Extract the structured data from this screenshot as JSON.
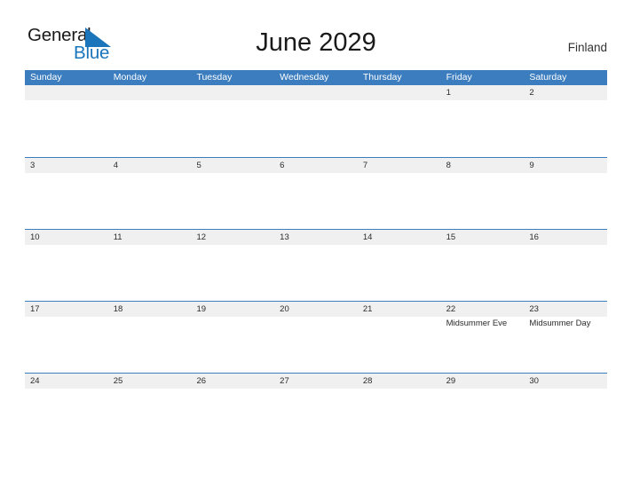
{
  "brand": {
    "name_part1": "General",
    "name_part2": "Blue",
    "flag_icon": "blue-triangle-flag-icon",
    "color_dark": "#1a1a1a",
    "color_blue": "#1b75bb"
  },
  "header": {
    "title": "June 2029",
    "region": "Finland"
  },
  "calendar": {
    "accent_color": "#3b7dbf",
    "band_color": "#f0f0f0",
    "weekdays": [
      "Sunday",
      "Monday",
      "Tuesday",
      "Wednesday",
      "Thursday",
      "Friday",
      "Saturday"
    ],
    "weeks": [
      [
        {
          "day": ""
        },
        {
          "day": ""
        },
        {
          "day": ""
        },
        {
          "day": ""
        },
        {
          "day": ""
        },
        {
          "day": "1"
        },
        {
          "day": "2"
        }
      ],
      [
        {
          "day": "3"
        },
        {
          "day": "4"
        },
        {
          "day": "5"
        },
        {
          "day": "6"
        },
        {
          "day": "7"
        },
        {
          "day": "8"
        },
        {
          "day": "9"
        }
      ],
      [
        {
          "day": "10"
        },
        {
          "day": "11"
        },
        {
          "day": "12"
        },
        {
          "day": "13"
        },
        {
          "day": "14"
        },
        {
          "day": "15"
        },
        {
          "day": "16"
        }
      ],
      [
        {
          "day": "17"
        },
        {
          "day": "18"
        },
        {
          "day": "19"
        },
        {
          "day": "20"
        },
        {
          "day": "21"
        },
        {
          "day": "22",
          "event": "Midsummer Eve"
        },
        {
          "day": "23",
          "event": "Midsummer Day"
        }
      ],
      [
        {
          "day": "24"
        },
        {
          "day": "25"
        },
        {
          "day": "26"
        },
        {
          "day": "27"
        },
        {
          "day": "28"
        },
        {
          "day": "29"
        },
        {
          "day": "30"
        }
      ]
    ]
  }
}
